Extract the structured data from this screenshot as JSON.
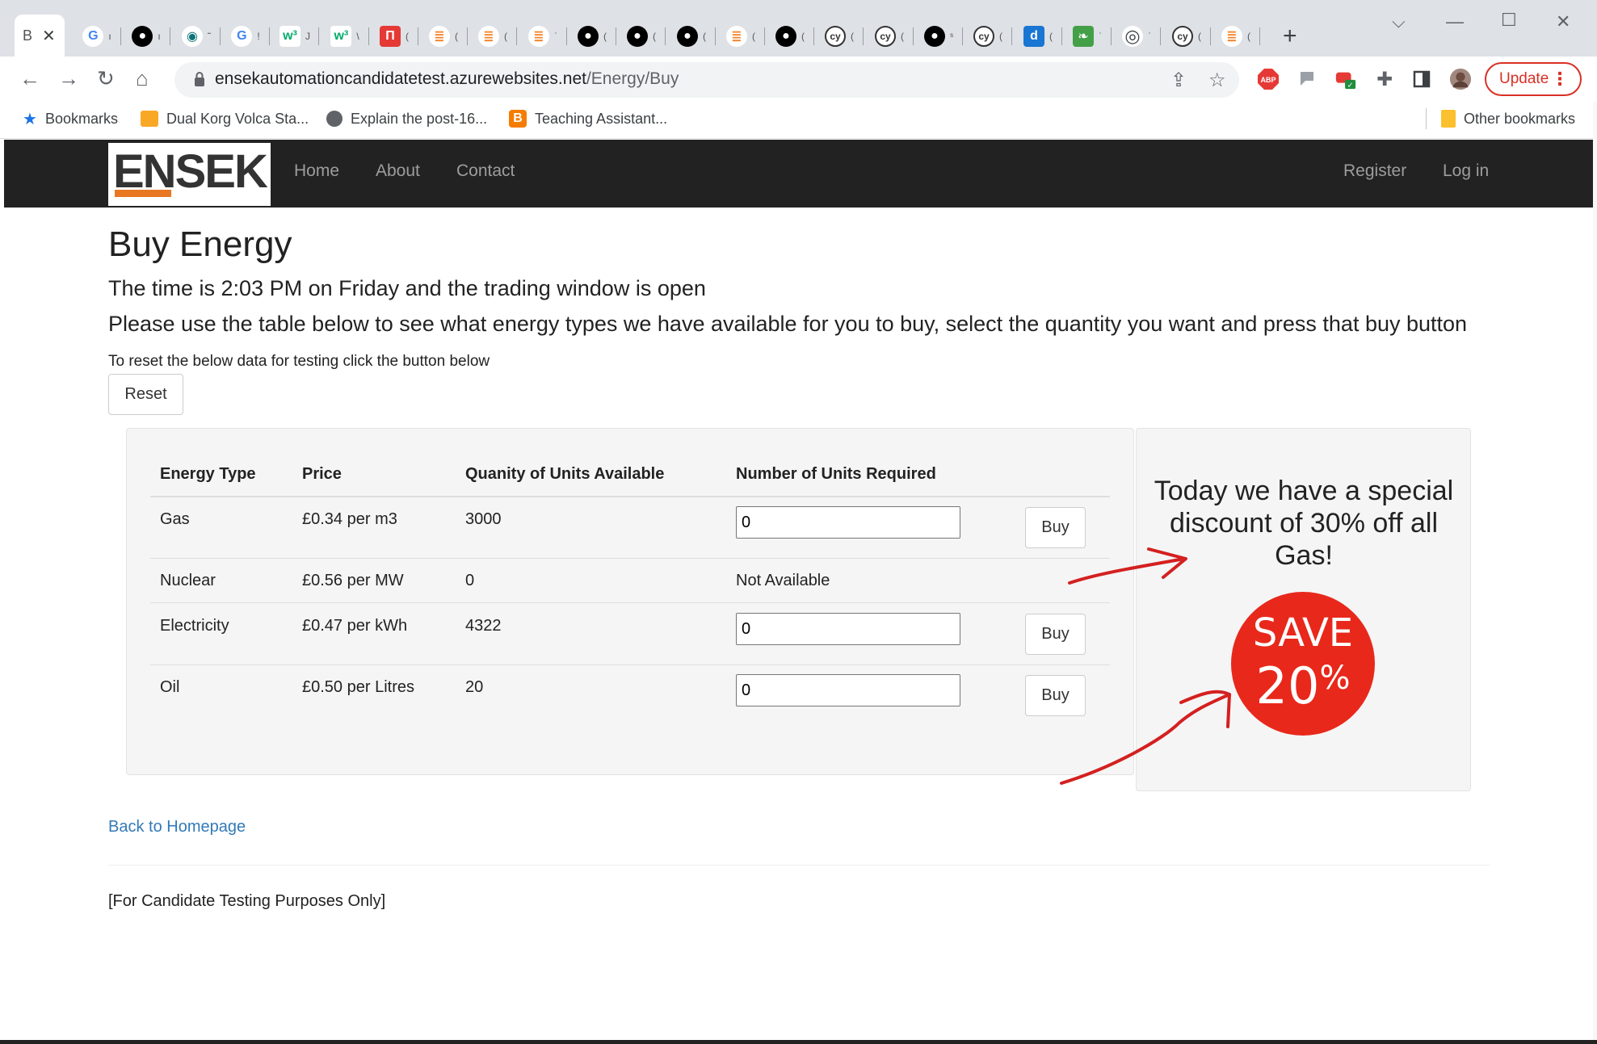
{
  "browser": {
    "active_tab_letter": "B",
    "tab_truncations": [
      "ı",
      "ı",
      "˜",
      "!",
      "J",
      "\\",
      "(",
      "(",
      "(",
      "ˈ",
      "(",
      "(",
      "(",
      "(",
      "(",
      "(",
      "(",
      "ˢ",
      "(",
      "(",
      "ˈ",
      "ˈ",
      "(",
      "(",
      "j"
    ],
    "url_host": "ensekautomationcandidatetest.azurewebsites.net",
    "url_path": "/Energy/Buy",
    "update_label": "Update",
    "bookmarks": [
      {
        "label": "Bookmarks",
        "icon": "star-icon"
      },
      {
        "label": "Dual Korg Volca Sta...",
        "icon": "bookmark-favicon"
      },
      {
        "label": "Explain the post-16...",
        "icon": "globe-icon"
      },
      {
        "label": "Teaching Assistant...",
        "icon": "blogger-icon"
      }
    ],
    "other_bookmarks": "Other bookmarks"
  },
  "nav": {
    "logo": "ENSEK",
    "links": [
      "Home",
      "About",
      "Contact"
    ],
    "right_links": [
      "Register",
      "Log in"
    ]
  },
  "page": {
    "title": "Buy Energy",
    "time_line": "The time is 2:03 PM on Friday and the trading window is open",
    "instructions": "Please use the table below to see what energy types we have available for you to buy, select the quantity you want and press that buy button",
    "reset_hint": "To reset the below data for testing click the button below",
    "reset_label": "Reset"
  },
  "table": {
    "headers": [
      "Energy Type",
      "Price",
      "Quanity of Units Available",
      "Number of Units Required"
    ],
    "rows": [
      {
        "type": "Gas",
        "price": "£0.34 per m3",
        "available": "3000",
        "required": "0",
        "buy": "Buy"
      },
      {
        "type": "Nuclear",
        "price": "£0.56 per MW",
        "available": "0",
        "status": "Not Available"
      },
      {
        "type": "Electricity",
        "price": "£0.47 per kWh",
        "available": "4322",
        "required": "0",
        "buy": "Buy"
      },
      {
        "type": "Oil",
        "price": "£0.50 per Litres",
        "available": "20",
        "required": "0",
        "buy": "Buy"
      }
    ]
  },
  "promo": {
    "text": "Today we have a special discount of 30% off all Gas!",
    "badge_word": "SAVE",
    "badge_number": "20",
    "badge_percent": "%"
  },
  "footer": {
    "back_link": "Back to Homepage",
    "note": "[For Candidate Testing Purposes Only]"
  },
  "colors": {
    "navbar": "#222222",
    "logo_accent": "#e87722",
    "badge": "#e8281b",
    "arrow": "#d42020",
    "link": "#337ab7",
    "update": "#d93025"
  }
}
